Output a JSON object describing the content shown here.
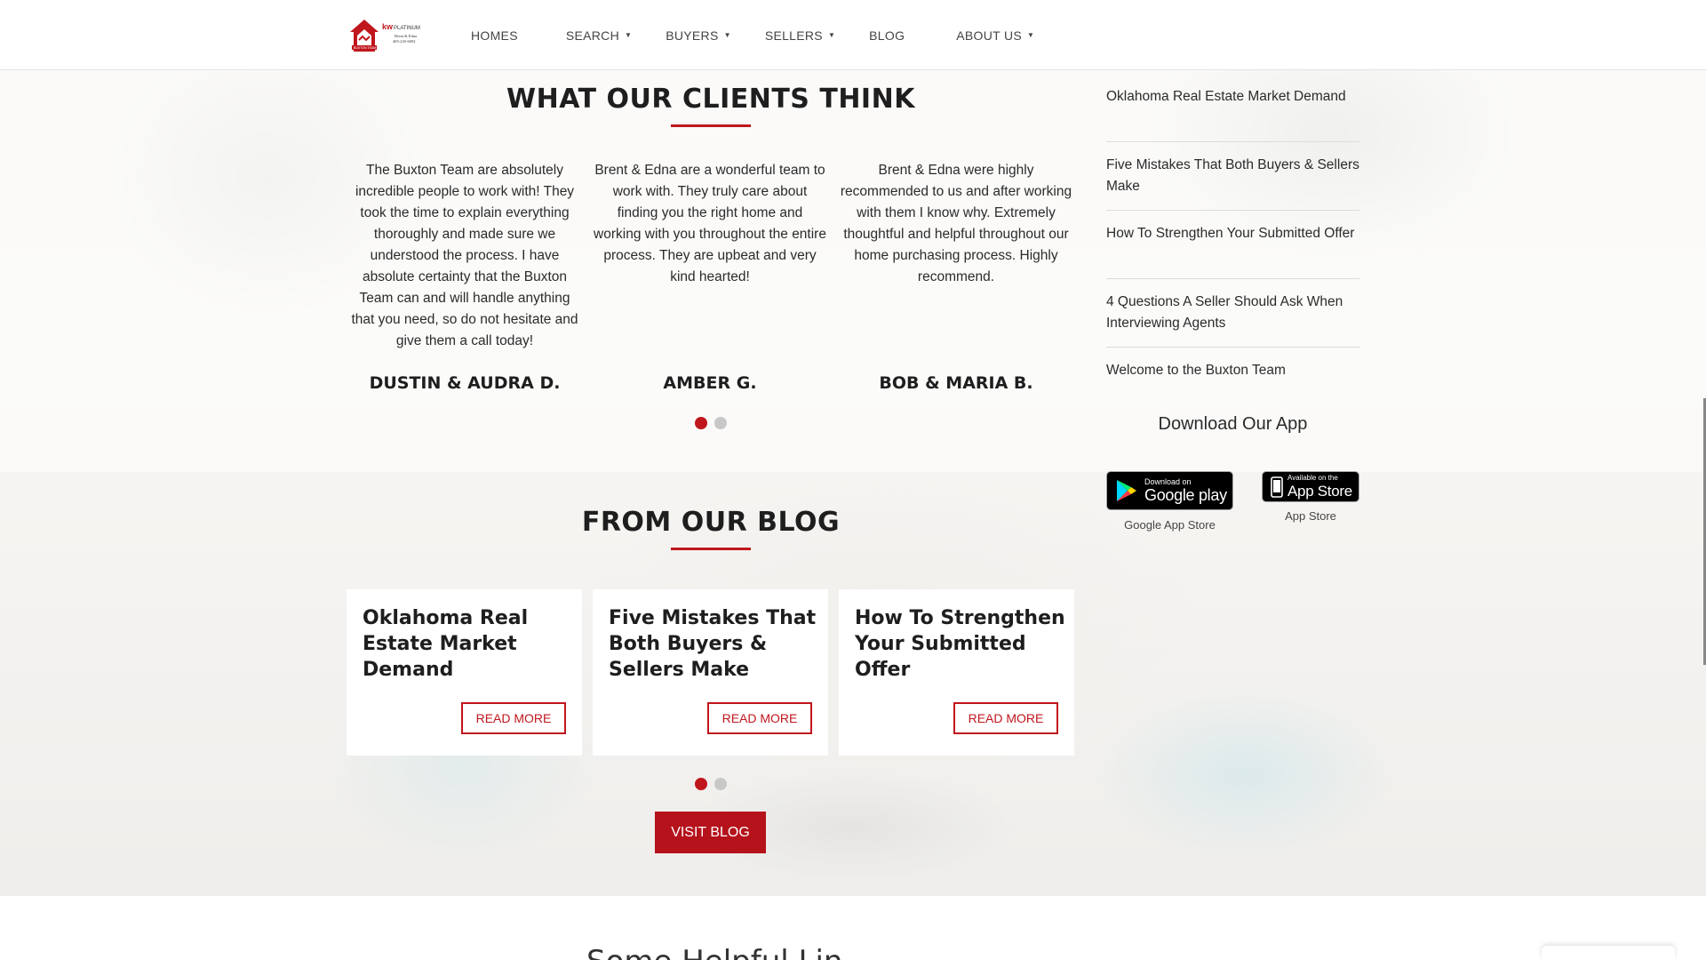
{
  "nav": {
    "items": [
      {
        "label": "HOMES",
        "dropdown": false
      },
      {
        "label": "SEARCH",
        "dropdown": true
      },
      {
        "label": "BUYERS",
        "dropdown": true
      },
      {
        "label": "SELLERS",
        "dropdown": true
      },
      {
        "label": "BLOG",
        "dropdown": false
      },
      {
        "label": "ABOUT US",
        "dropdown": true
      }
    ],
    "logo": {
      "brand": "kw PLATINUM",
      "tagline": "Brent & Edna",
      "phone": "405-245-6092",
      "team": "BUXTON TEAM"
    }
  },
  "testimonials": {
    "title": "WHAT OUR CLIENTS THINK",
    "items": [
      {
        "quote": "The Buxton Team are absolutely incredible people to work with! They took the time to explain everything thoroughly and made sure we understood the process. I have absolute certainty that the Buxton Team can and will handle anything that you need, so do not hesitate and give them a call today!",
        "name": "DUSTIN & AUDRA D."
      },
      {
        "quote": "Brent & Edna are a wonderful team to work with. They truly care about finding you the right home and working with you throughout the entire process. They are upbeat and very kind hearted!",
        "name": "AMBER G."
      },
      {
        "quote": "Brent & Edna were highly recommended to us and after working with them I know why. Extremely thoughtful and helpful throughout our home purchasing process. Highly recommend.",
        "name": "BOB & MARIA B."
      }
    ],
    "active_page": 1,
    "page_count": 2
  },
  "sidebar": {
    "links": [
      "Oklahoma Real Estate Market Demand",
      "Five Mistakes That Both Buyers & Sellers Make",
      "How To Strengthen Your Submitted Offer",
      "4 Questions A Seller Should Ask When Interviewing Agents",
      "Welcome to the Buxton Team"
    ],
    "app_title": "Download Our App",
    "google_badge": {
      "small": "Download on",
      "big": "Google play",
      "caption": "Google App Store"
    },
    "apple_badge": {
      "small": "Available on the",
      "big": "App Store",
      "caption": "App Store"
    }
  },
  "blog": {
    "title": "FROM OUR BLOG",
    "cards": [
      {
        "title": "Oklahoma Real Estate Market Demand",
        "button": "READ MORE"
      },
      {
        "title": "Five Mistakes That Both Buyers & Sellers Make",
        "button": "READ MORE"
      },
      {
        "title": "How To Strengthen Your Submitted Offer",
        "button": "READ MORE"
      }
    ],
    "active_page": 1,
    "page_count": 2,
    "visit_label": "VISIT BLOG"
  },
  "next_section": {
    "title_partial": "Some Helpful Lin"
  },
  "colors": {
    "accent": "#c0161d",
    "button": "#b5121b"
  }
}
